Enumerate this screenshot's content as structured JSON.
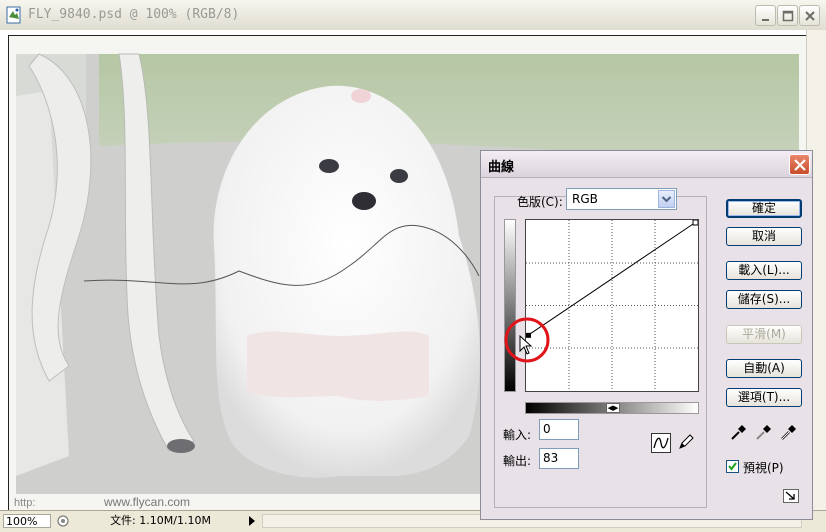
{
  "window": {
    "title": "FLY_9840.psd @ 100% (RGB/8)"
  },
  "watermark": {
    "text": "http:",
    "site": "www.flycan.com"
  },
  "statusbar": {
    "zoom": "100%",
    "doc": "文件: 1.10M/1.10M"
  },
  "dialog": {
    "title": "曲線",
    "channel_label": "色版(C):",
    "channel_value": "RGB",
    "input_label": "輸入:",
    "input_value": "0",
    "output_label": "輸出:",
    "output_value": "83",
    "buttons": {
      "ok": "確定",
      "cancel": "取消",
      "load": "載入(L)...",
      "save": "儲存(S)...",
      "smooth": "平滑(M)",
      "auto": "自動(A)",
      "options": "選項(T)..."
    },
    "preview_label": "預視(P)",
    "preview_checked": true
  },
  "chart_data": {
    "type": "line",
    "xlim": [
      0,
      255
    ],
    "ylim": [
      0,
      255
    ],
    "points": [
      [
        0,
        83
      ],
      [
        255,
        255
      ]
    ],
    "grid": true
  },
  "colors": {
    "highlight_circle": "#E0151B",
    "dialog_bg": "#E8E1E8"
  }
}
